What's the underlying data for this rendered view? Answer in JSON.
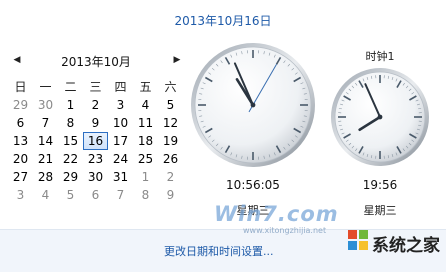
{
  "header": {
    "date": "2013年10月16日"
  },
  "calendar": {
    "month_title": "2013年10月",
    "prev_icon": "triangle-left-icon",
    "next_icon": "triangle-right-icon",
    "weekdays": [
      "日",
      "一",
      "二",
      "三",
      "四",
      "五",
      "六"
    ],
    "weeks": [
      [
        "29",
        "30",
        "1",
        "2",
        "3",
        "4",
        "5"
      ],
      [
        "6",
        "7",
        "8",
        "9",
        "10",
        "11",
        "12"
      ],
      [
        "13",
        "14",
        "15",
        "16",
        "17",
        "18",
        "19"
      ],
      [
        "20",
        "21",
        "22",
        "23",
        "24",
        "25",
        "26"
      ],
      [
        "27",
        "28",
        "29",
        "30",
        "31",
        "1",
        "2"
      ],
      [
        "3",
        "4",
        "5",
        "6",
        "7",
        "8",
        "9"
      ]
    ],
    "today": "16"
  },
  "clocks": {
    "main": {
      "time": "10:56:05",
      "label": "星期三"
    },
    "extra": {
      "title": "时钟1",
      "time": "19:56",
      "label": "星期三"
    }
  },
  "footer": {
    "link": "更改日期和时间设置..."
  },
  "watermark": {
    "text": "Win7.com",
    "url": "www.xitongzhijia.net",
    "logo_text": "系统之家"
  },
  "colors": {
    "accent": "#1e5aa8",
    "today_border": "#2c6ec2"
  }
}
